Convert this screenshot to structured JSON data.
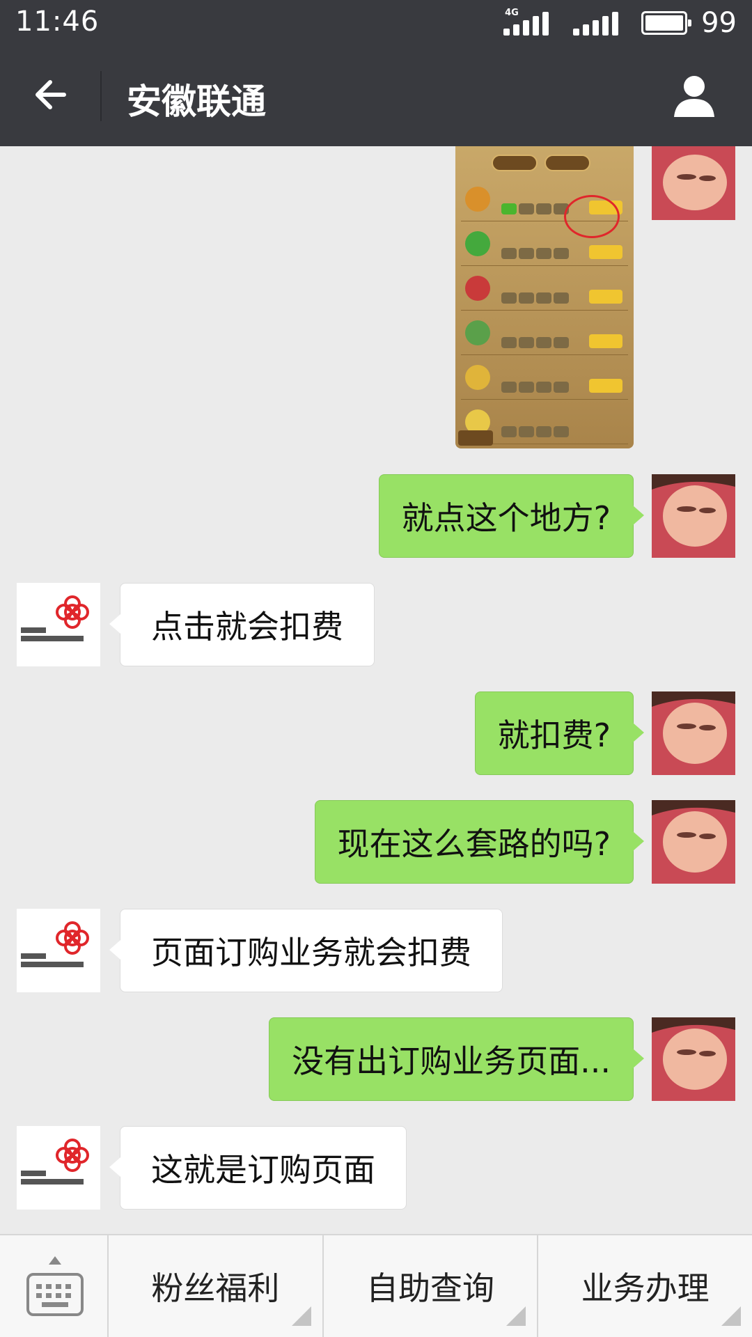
{
  "status_bar": {
    "time": "11:46",
    "network": "4G",
    "battery": "99"
  },
  "header": {
    "title": "安徽联通"
  },
  "messages": [
    {
      "from": "me",
      "type": "image",
      "image": "game-upgrade-screenshot"
    },
    {
      "from": "me",
      "type": "text",
      "text": "就点这个地方?"
    },
    {
      "from": "service",
      "type": "text",
      "text": "点击就会扣费"
    },
    {
      "from": "me",
      "type": "text",
      "text": "就扣费?"
    },
    {
      "from": "me",
      "type": "text",
      "text": "现在这么套路的吗?"
    },
    {
      "from": "service",
      "type": "text",
      "text": "页面订购业务就会扣费"
    },
    {
      "from": "me",
      "type": "text",
      "text": "没有出订购业务页面..."
    },
    {
      "from": "service",
      "type": "text",
      "text": "这就是订购页面"
    }
  ],
  "bottom_menu": {
    "items": [
      {
        "label": "粉丝福利"
      },
      {
        "label": "自助查询"
      },
      {
        "label": "业务办理"
      }
    ]
  },
  "colors": {
    "topbar": "#393a3f",
    "outgoing_bubble": "#98e165",
    "incoming_bubble": "#ffffff",
    "chat_background": "#ebebeb",
    "brand_red": "#e0262b"
  },
  "icons": {
    "back": "arrow-left-icon",
    "profile": "person-icon",
    "keyboard": "keyboard-icon"
  }
}
